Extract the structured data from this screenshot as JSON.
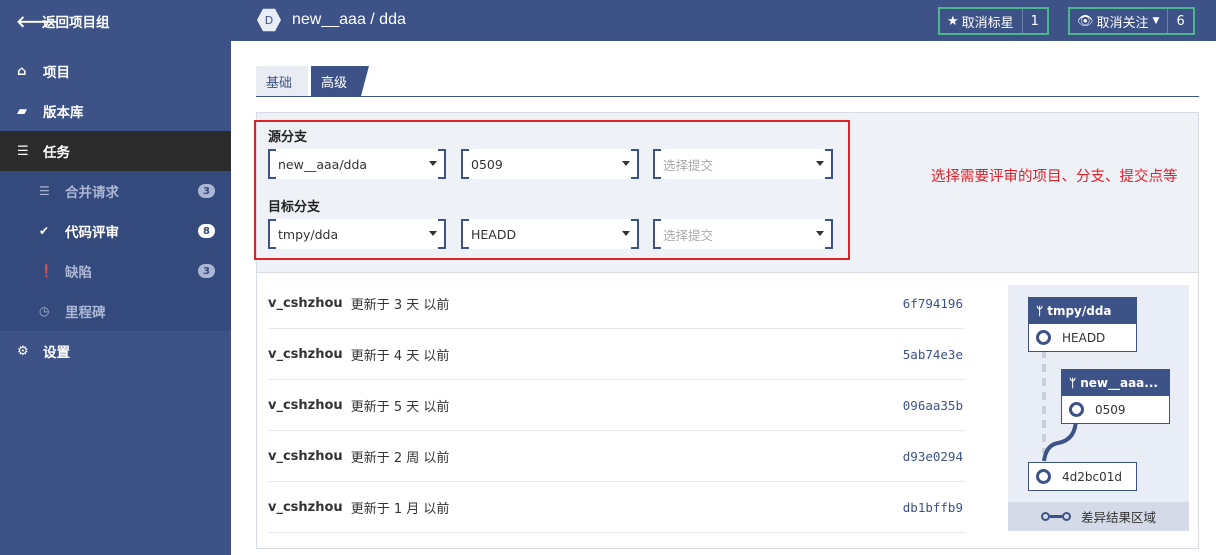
{
  "topbar": {
    "back_label": "返回项目组",
    "project_initial": "D",
    "project_name": "new__aaa / dda",
    "star_label": "取消标星",
    "star_count": "1",
    "watch_label": "取消关注",
    "watch_count": "6"
  },
  "sidebar": {
    "items": [
      {
        "label": "项目",
        "icon": "home-icon"
      },
      {
        "label": "版本库",
        "icon": "folder-icon"
      },
      {
        "label": "任务",
        "icon": "tasks-icon"
      },
      {
        "label": "设置",
        "icon": "gears-icon"
      }
    ],
    "sub_items": [
      {
        "label": "合并请求",
        "badge": "3",
        "icon": "merge-icon"
      },
      {
        "label": "代码评审",
        "badge": "8",
        "icon": "check-icon"
      },
      {
        "label": "缺陷",
        "badge": "3",
        "icon": "alert-icon"
      },
      {
        "label": "里程碑",
        "icon": "clock-icon"
      }
    ]
  },
  "tabs": [
    "基础",
    "高级"
  ],
  "filters": {
    "source_label": "源分支",
    "target_label": "目标分支",
    "source": {
      "project": "new__aaa/dda",
      "branch": "0509",
      "commit_placeholder": "选择提交"
    },
    "target": {
      "project": "tmpy/dda",
      "branch": "HEADD",
      "commit_placeholder": "选择提交"
    },
    "annotation": "选择需要评审的项目、分支、提交点等"
  },
  "commits": [
    {
      "author": "v_cshzhou",
      "text": "更新于 3 天 以前",
      "hash": "6f794196"
    },
    {
      "author": "v_cshzhou",
      "text": "更新于 4 天 以前",
      "hash": "5ab74e3e"
    },
    {
      "author": "v_cshzhou",
      "text": "更新于 5 天 以前",
      "hash": "096aa35b"
    },
    {
      "author": "v_cshzhou",
      "text": "更新于 2 周 以前",
      "hash": "d93e0294"
    },
    {
      "author": "v_cshzhou",
      "text": "更新于 1 月 以前",
      "hash": "db1bffb9"
    }
  ],
  "graph": {
    "target_branch": "tmpy/dda",
    "target_ref": "HEADD",
    "source_branch": "new__aaa...",
    "source_ref": "0509",
    "base_commit": "4d2bc01d",
    "footer": "差异结果区域"
  },
  "colors": {
    "brand": "#3d5286",
    "accent_border": "#4fb58e",
    "annotation": "#e0212a"
  }
}
